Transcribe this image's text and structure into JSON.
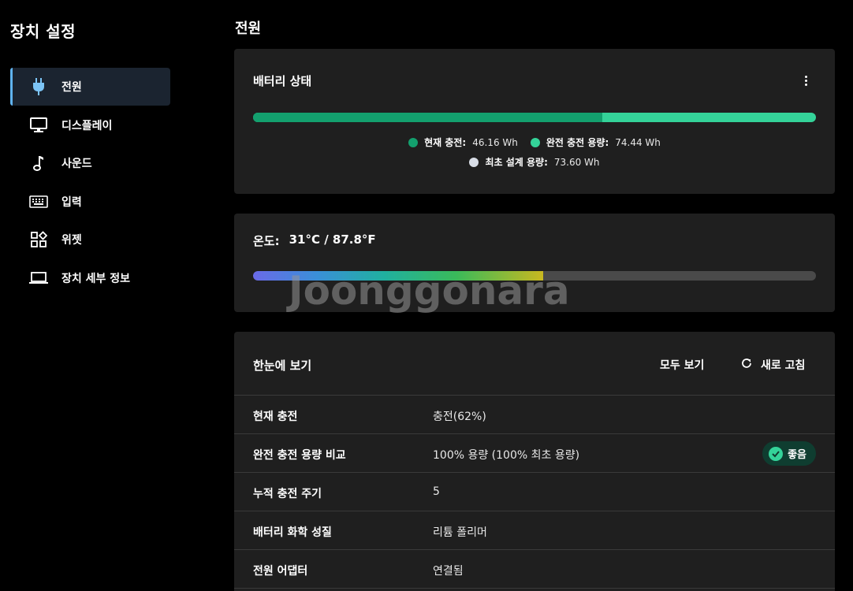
{
  "app_title": "장치 설정",
  "sidebar": {
    "items": [
      {
        "label": "전원",
        "icon": "power-plug-icon",
        "active": true
      },
      {
        "label": "디스플레이",
        "icon": "monitor-icon"
      },
      {
        "label": "사운드",
        "icon": "music-note-icon"
      },
      {
        "label": "입력",
        "icon": "keyboard-icon"
      },
      {
        "label": "위젯",
        "icon": "widgets-icon"
      },
      {
        "label": "장치 세부 정보",
        "icon": "laptop-icon"
      }
    ]
  },
  "main": {
    "page_title": "전원",
    "battery": {
      "title": "배터리 상태",
      "charge_fraction": 0.62,
      "legend": [
        {
          "key": "현재 충전:",
          "value": "46.16 Wh",
          "color": "#13a06e"
        },
        {
          "key": "완전 충전 용량:",
          "value": "74.44 Wh",
          "color": "#34d399"
        },
        {
          "key": "최초 설계 용량:",
          "value": "73.60 Wh",
          "color": "#d8dde6"
        }
      ]
    },
    "temperature": {
      "label": "온도:",
      "value": "31°C / 87.8°F",
      "level_fraction": 0.516
    },
    "glance": {
      "title": "한눈에 보기",
      "view_all": "모두 보기",
      "refresh": "새로 고침",
      "rows": [
        {
          "key": "현재 충전",
          "value": "충전(62%)"
        },
        {
          "key": "완전 충전 용량 비교",
          "value": "100% 용량 (100% 최초 용량)",
          "badge": "좋음"
        },
        {
          "key": "누적 충전 주기",
          "value": "5"
        },
        {
          "key": "배터리 화학 성질",
          "value": "리튬 폴리머"
        },
        {
          "key": "전원 어댑터",
          "value": "연결됨"
        }
      ]
    }
  },
  "watermark": "Joonggonara",
  "colors": {
    "accent": "#60b3f0",
    "good": "#34d399",
    "charge": "#13a06e"
  }
}
